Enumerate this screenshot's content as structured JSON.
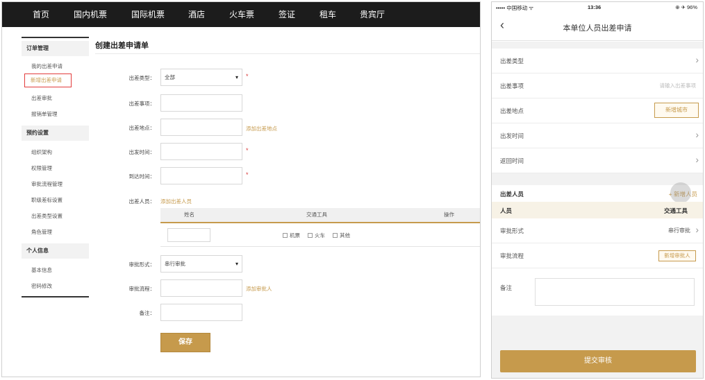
{
  "topnav": {
    "items": [
      "首页",
      "国内机票",
      "国际机票",
      "酒店",
      "火车票",
      "签证",
      "租车",
      "贵宾厅"
    ]
  },
  "sidebar": {
    "section1": "订单管理",
    "section1_items": [
      "我的出差申请",
      "新增出差申请",
      "出差审批",
      "报销单管理"
    ],
    "section2": "预约设置",
    "section2_items": [
      "组织架构",
      "权限管理",
      "审批流程管理",
      "职级差标设置",
      "出差类型设置",
      "角色管理"
    ],
    "section3": "个人信息",
    "section3_items": [
      "基本信息",
      "密码修改"
    ]
  },
  "form": {
    "title": "创建出差申请单",
    "type_label": "出差类型：",
    "type_value": "全部",
    "matter_label": "出差事项：",
    "place_label": "出差地点：",
    "add_place": "添加出差地点",
    "depart_label": "出发时间：",
    "arrive_label": "到达时间：",
    "people_label": "出差人员：",
    "add_people": "添加出差人员",
    "table_headers": [
      "姓名",
      "交通工具",
      "操作"
    ],
    "transport_options": [
      "机票",
      "火车",
      "其他"
    ],
    "approval_mode_label": "审批形式：",
    "approval_mode_value": "串行审批",
    "approval_flow_label": "审批流程：",
    "add_approver": "添加审批人",
    "remark_label": "备注：",
    "save": "保存"
  },
  "mobile": {
    "status": {
      "carrier": "••••• 中国移动 ᯤ",
      "time": "13:36",
      "battery": "⊕ ✈ 96%"
    },
    "title": "本单位人员出差申请",
    "rows": {
      "type": "出差类型",
      "matter": "出差事项",
      "matter_placeholder": "请输入出差事项",
      "place": "出差地点",
      "add_city": "新增城市",
      "depart": "出发时间",
      "return": "返回时间"
    },
    "people": {
      "title": "出差人员",
      "add": "+ 新增人员",
      "col_person": "人员",
      "col_transport": "交通工具"
    },
    "approval_mode_label": "审批形式",
    "approval_mode_value": "串行审批",
    "approval_flow_label": "审批流程",
    "add_approver": "新增审批人",
    "remark": "备注",
    "submit": "提交审核"
  },
  "colors": {
    "accent": "#c69a4c",
    "nav_bg": "#1c1c1c",
    "required": "#d83b3b"
  }
}
